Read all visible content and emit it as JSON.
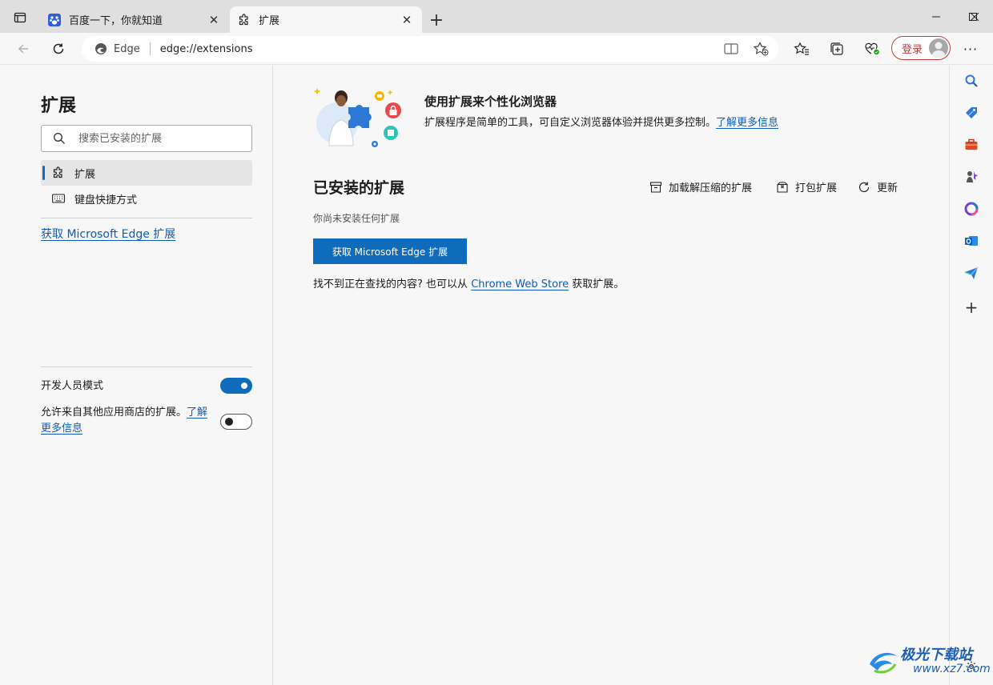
{
  "tabs": [
    {
      "title": "百度一下，你就知道",
      "icon": "baidu-paw-icon"
    },
    {
      "title": "扩展",
      "icon": "puzzle-icon"
    }
  ],
  "address": {
    "site_label": "Edge",
    "url": "edge://extensions"
  },
  "toolbar": {
    "login_label": "登录"
  },
  "left": {
    "title": "扩展",
    "search_placeholder": "搜索已安装的扩展",
    "nav": [
      {
        "label": "扩展",
        "icon": "puzzle-icon",
        "selected": true
      },
      {
        "label": "键盘快捷方式",
        "icon": "keyboard-icon",
        "selected": false
      }
    ],
    "get_link": "获取 Microsoft Edge 扩展",
    "dev_mode_label": "开发人员模式",
    "dev_mode_on": true,
    "allow_other_stores_label": "允许来自其他应用商店的扩展。",
    "allow_other_stores_link": "了解更多信息",
    "allow_other_stores_on": false
  },
  "main": {
    "hero_title": "使用扩展来个性化浏览器",
    "hero_desc": "扩展程序是简单的工具，可自定义浏览器体验并提供更多控制。",
    "hero_link": "了解更多信息",
    "installed_title": "已安装的扩展",
    "actions": [
      {
        "label": "加载解压缩的扩展",
        "icon": "archive-box-icon"
      },
      {
        "label": "打包扩展",
        "icon": "package-icon"
      },
      {
        "label": "更新",
        "icon": "refresh-icon"
      }
    ],
    "empty_text": "你尚未安装任何扩展",
    "get_button": "获取 Microsoft Edge 扩展",
    "hint_prefix": "找不到正在查找的内容? 也可以从",
    "hint_link": "Chrome Web Store",
    "hint_suffix": "获取扩展。"
  },
  "watermark": {
    "title": "极光下载站",
    "sub": "www.xz7.com"
  },
  "colors": {
    "accent": "#0f6cbd",
    "link": "#0f5cb5",
    "login_border": "#c43b3b"
  }
}
